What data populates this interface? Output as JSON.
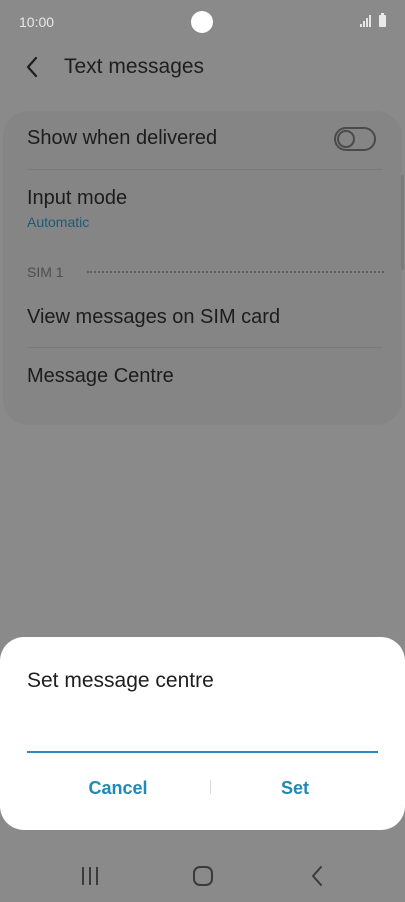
{
  "status_bar": {
    "time": "10:00"
  },
  "app_bar": {
    "title": "Text messages"
  },
  "settings": {
    "show_when_delivered": {
      "label": "Show when delivered",
      "enabled": false
    },
    "input_mode": {
      "label": "Input mode",
      "value": "Automatic"
    },
    "section_sim": "SIM 1",
    "view_messages": {
      "label": "View messages on SIM card"
    },
    "message_centre": {
      "label": "Message Centre"
    }
  },
  "dialog": {
    "title": "Set message centre",
    "input_value": "",
    "cancel_label": "Cancel",
    "set_label": "Set"
  },
  "colors": {
    "accent": "#1f8ab5",
    "dim_background": "#8a8a8a",
    "dialog_background": "#ffffff"
  },
  "icons": {
    "back": "chevron-left-icon",
    "recents": "recents-icon",
    "home": "home-icon",
    "nav_back": "nav-back-icon"
  }
}
